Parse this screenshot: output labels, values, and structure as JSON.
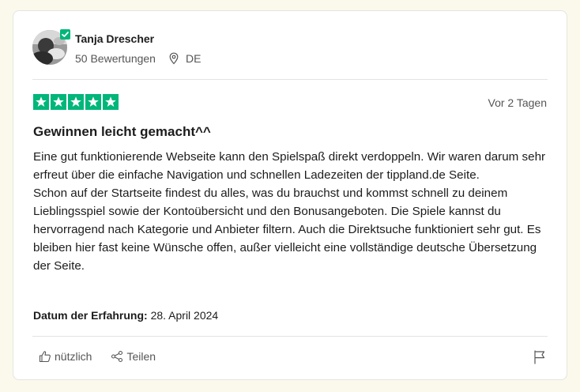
{
  "reviewer": {
    "name": "Tanja Drescher",
    "reviews_count": "50 Bewertungen",
    "country": "DE"
  },
  "review": {
    "rating": 5,
    "date_relative": "Vor 2 Tagen",
    "title": "Gewinnen leicht gemacht^^",
    "paragraphs": [
      "Eine gut funktionierende Webseite kann den Spielspaß direkt verdoppeln. Wir waren darum sehr erfreut über die einfache Navigation und schnellen Ladezeiten der tippland.de Seite.",
      "Schon auf der Startseite findest du alles, was du brauchst und kommst schnell zu deinem Lieblingsspiel sowie der Kontoübersicht und den Bonusangeboten. Die Spiele kannst du hervorragend nach Kategorie und Anbieter filtern. Auch die Direktsuche funktioniert sehr gut. Es bleiben hier fast keine Wünsche offen, außer vielleicht eine vollständige deutsche Übersetzung der Seite."
    ],
    "experience_label": "Datum der Erfahrung:",
    "experience_date": "28. April 2024"
  },
  "actions": {
    "useful_label": "nützlich",
    "share_label": "Teilen"
  },
  "icons": {
    "verified": "verified-check-icon",
    "location": "location-pin-icon",
    "star": "star-icon",
    "useful": "thumbs-up-icon",
    "share": "share-icon",
    "report": "flag-icon"
  },
  "colors": {
    "star_green": "#00b67a",
    "background": "#fbf9ec",
    "muted_text": "#555555"
  }
}
